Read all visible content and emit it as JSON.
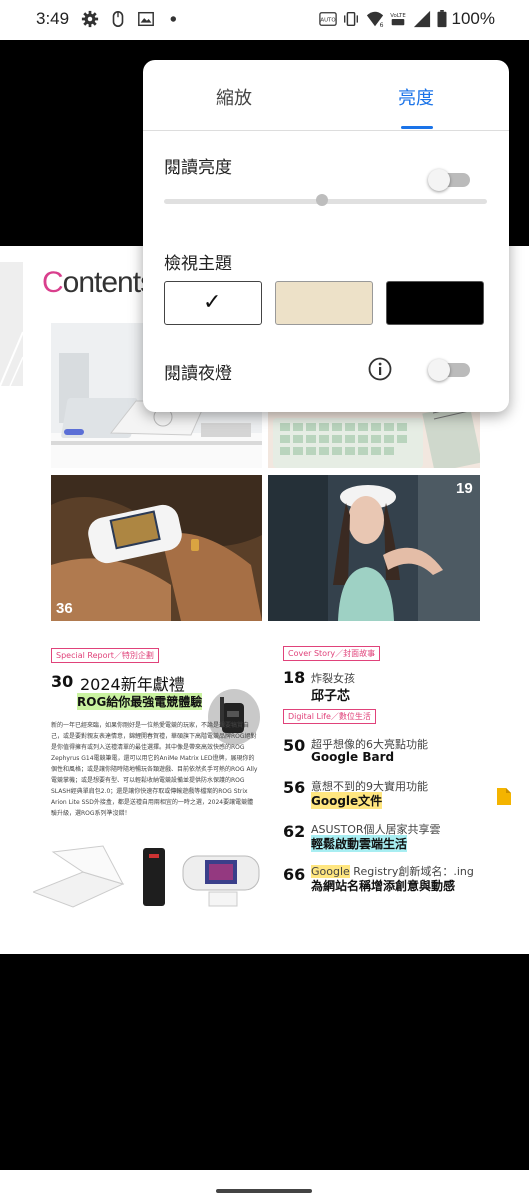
{
  "status_bar": {
    "time": "3:49",
    "battery": "100%",
    "icons": [
      "gear-icon",
      "mouse-icon",
      "image-icon",
      "dot-icon",
      "auto-hd-icon",
      "vibrate-icon",
      "wifi-icon",
      "volte-icon",
      "signal-icon",
      "battery-icon"
    ]
  },
  "page": {
    "contents_title_first": "C",
    "contents_title_rest": "ontents",
    "photo_badges": [
      "36",
      "19"
    ],
    "left_article": {
      "tag": "Special Report／特別企劃",
      "number": "30",
      "title": "2024新年獻禮",
      "subtitle": "ROG給你最強電競體驗",
      "body": "新的一年已經來臨，如果你剛好是一位熱愛電競的玩家，不論是想要犒賞自己，或是要對親友表達情意，錦鯉開春賀禮，華碩旗下高階電競品牌ROG絕對是你值得擁有或列入送禮清單的最佳選擇。其中像是帶來高效快感的ROG Zephyrus G14電競筆電，還可以用它的AniMe Matrix LED燈牌，展現你的個性和風格；或是讓你隨時隨地暢玩各類遊戲、目前依然炙手可熱的ROG Ally電競掌機；或是想要有型、可以輕鬆收納電競設備並提供防水保護的ROG SLASH經典單肩包2.0；還是讓你快速存取或傳輸遊戲等檔案的ROG Strix Arion Lite SSD外接盒，都是送禮自用兩相宜的一時之選，2024要讓電競體驗升級，選ROG系列準沒錯！"
    },
    "right_articles": {
      "cover_tag": "Cover Story／封面故事",
      "cover_number": "18",
      "cover_sub": "炸裂女孩",
      "cover_title": "邱子芯",
      "digital_tag": "Digital Life／數位生活",
      "items": [
        {
          "number": "50",
          "sub": "超乎想像的6大亮點功能",
          "title": "Google Bard"
        },
        {
          "number": "56",
          "sub": "意想不到的9大實用功能",
          "title": "Google文件"
        },
        {
          "number": "62",
          "sub": "ASUSTOR個人居家共享雲",
          "title": "輕鬆啟動雲端生活"
        },
        {
          "number": "66",
          "sub_highlight": "Google",
          "sub_rest": " Registry創新域名：.ing",
          "title": "為網站名稱增添創意與動感"
        }
      ]
    }
  },
  "dialog": {
    "tabs": [
      {
        "label": "縮放",
        "selected": false
      },
      {
        "label": "亮度",
        "selected": true
      }
    ],
    "brightness_label": "閱讀亮度",
    "brightness_auto_toggle": false,
    "brightness_level": 0.49,
    "theme_label": "檢視主題",
    "themes": [
      {
        "name": "white",
        "color": "#ffffff",
        "selected": true,
        "check": "✓"
      },
      {
        "name": "sepia",
        "color": "#ede1c8",
        "selected": false
      },
      {
        "name": "black",
        "color": "#000000",
        "selected": false
      }
    ],
    "night_light_label": "閱讀夜燈",
    "night_light_on": false,
    "accent": "#1a73e8"
  }
}
